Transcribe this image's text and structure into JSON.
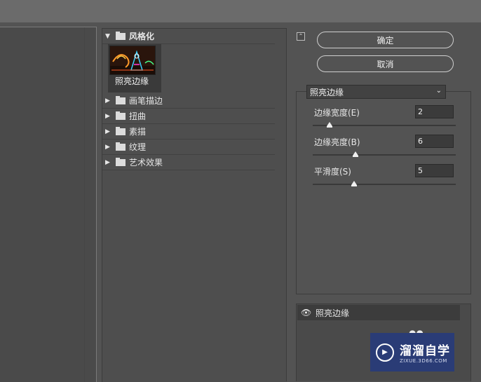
{
  "gallery": {
    "open_category": "风格化",
    "selected_filter": "照亮边缘",
    "categories": [
      "画笔描边",
      "扭曲",
      "素描",
      "纹理",
      "艺术效果"
    ]
  },
  "buttons": {
    "ok": "确定",
    "cancel": "取消"
  },
  "settings": {
    "filter_select": "照亮边缘",
    "params": [
      {
        "label": "边缘宽度(E)",
        "value": "2",
        "slider_fraction": 0.12
      },
      {
        "label": "边缘亮度(B)",
        "value": "6",
        "slider_fraction": 0.3
      },
      {
        "label": "平滑度(S)",
        "value": "5",
        "slider_fraction": 0.29
      }
    ]
  },
  "layers": {
    "effect_name": "照亮边缘"
  },
  "watermark": {
    "title": "溜溜自学",
    "url": "ZIXUE.3D66.COM"
  },
  "icons": [
    "collapse-icon",
    "chevron-down-icon",
    "folder-icon",
    "triangle-expand-icon",
    "eye-icon"
  ],
  "colors": {
    "panel_bg": "#535353",
    "watermark_bg": "#2a3c76"
  }
}
